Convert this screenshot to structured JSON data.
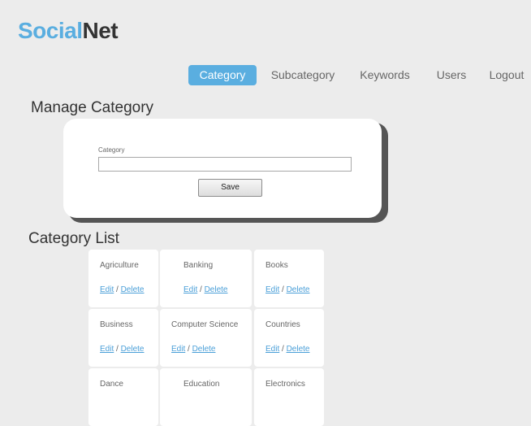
{
  "brand": {
    "part1": "Social",
    "part2": "Net"
  },
  "nav": {
    "items": [
      {
        "label": "Category"
      },
      {
        "label": "Subcategory"
      },
      {
        "label": "Keywords"
      },
      {
        "label": "Users"
      },
      {
        "label": "Logout"
      }
    ],
    "active": "Category"
  },
  "manage": {
    "title": "Manage Category",
    "field_label": "Category",
    "input_value": "",
    "save_label": "Save"
  },
  "list": {
    "title": "Category List",
    "edit_label": "Edit",
    "separator": " / ",
    "delete_label": "Delete",
    "categories": [
      {
        "name": "Agriculture"
      },
      {
        "name": "Banking"
      },
      {
        "name": "Books"
      },
      {
        "name": "Business"
      },
      {
        "name": "Computer Science"
      },
      {
        "name": "Countries"
      },
      {
        "name": "Dance"
      },
      {
        "name": "Education"
      },
      {
        "name": "Electronics"
      }
    ]
  },
  "colors": {
    "accent": "#5aaee0",
    "link": "#4a9fd8",
    "background": "#ececec"
  }
}
